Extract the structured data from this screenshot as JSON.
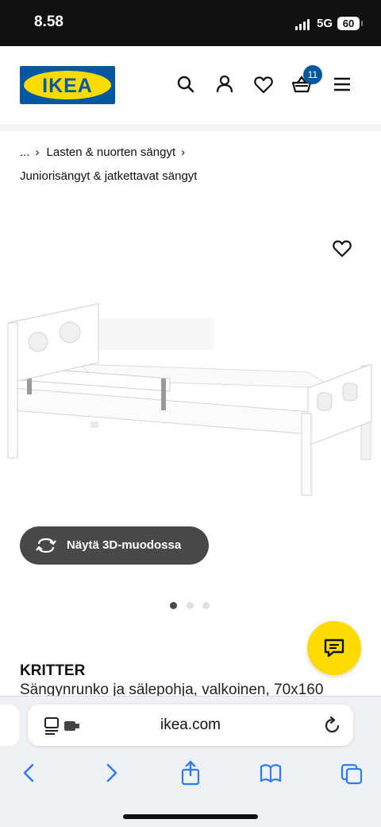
{
  "status_bar": {
    "time": "8.58",
    "network": "5G",
    "battery": "60"
  },
  "header": {
    "logo_text": "IKEA",
    "cart_count": "11",
    "icons": [
      "search-icon",
      "user-icon",
      "heart-icon",
      "basket-icon",
      "menu-icon"
    ]
  },
  "breadcrumb": {
    "ellipsis": "...",
    "category": "Lasten & nuorten sängyt",
    "subcategory": "Juniorisängyt & jatkettavat sängyt"
  },
  "gallery": {
    "button_3d_label": "Näytä 3D-muodossa",
    "image_count": 3,
    "active_image": 1
  },
  "product": {
    "name": "KRITTER",
    "description": "Sängynrunko ja sälepohja, valkoinen, 70x160"
  },
  "browser": {
    "url": "ikea.com",
    "nav": [
      "back-icon",
      "forward-icon",
      "share-icon",
      "bookmarks-icon",
      "tabs-icon"
    ]
  },
  "colors": {
    "ikea_blue": "#0058a3",
    "ikea_yellow": "#ffdb00",
    "button_dark": "#484848",
    "browser_accent": "#2f7bf5"
  }
}
